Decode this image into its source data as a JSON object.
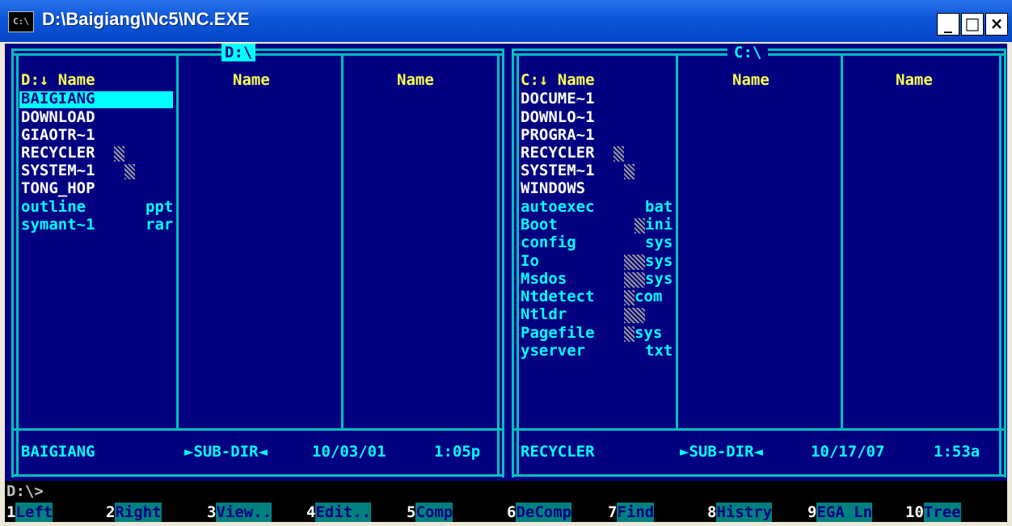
{
  "window": {
    "title": "D:\\Baigiang\\Nc5\\NC.EXE",
    "icon_label": "C:\\",
    "minimize": "_",
    "maximize": "□",
    "close": "×"
  },
  "left_panel": {
    "drive_header": "D:\\",
    "col1_header": "D:↓ Name",
    "col2_header": "Name",
    "col3_header": "Name",
    "files": [
      {
        "name": "BAIGIANG",
        "ext": "",
        "type": "dir",
        "selected": true
      },
      {
        "name": "DOWNLOAD",
        "ext": "",
        "type": "dir"
      },
      {
        "name": "GIAOTR~1",
        "ext": "",
        "type": "dir"
      },
      {
        "name": "RECYCLER",
        "ext": "",
        "type": "dir",
        "hidden": true
      },
      {
        "name": "SYSTEM~1",
        "ext": "",
        "type": "dir",
        "hidden": true
      },
      {
        "name": "TONG_HOP",
        "ext": "",
        "type": "dir"
      },
      {
        "name": "outline",
        "ext": "ppt",
        "type": "file"
      },
      {
        "name": "symant~1",
        "ext": "rar",
        "type": "file"
      }
    ],
    "status_name": "BAIGIANG",
    "status_type": "►SUB-DIR◄",
    "status_date": "10/03/01",
    "status_time": "1:05p"
  },
  "right_panel": {
    "drive_header": "C:\\",
    "col1_header": "C:↓ Name",
    "col2_header": "Name",
    "col3_header": "Name",
    "files": [
      {
        "name": "DOCUME~1",
        "ext": "",
        "type": "dir"
      },
      {
        "name": "DOWNLO~1",
        "ext": "",
        "type": "dir"
      },
      {
        "name": "PROGRA~1",
        "ext": "",
        "type": "dir"
      },
      {
        "name": "RECYCLER",
        "ext": "",
        "type": "dir",
        "hidden": true
      },
      {
        "name": "SYSTEM~1",
        "ext": "",
        "type": "dir",
        "hidden": true
      },
      {
        "name": "WINDOWS",
        "ext": "",
        "type": "dir"
      },
      {
        "name": "autoexec",
        "ext": "bat",
        "type": "file"
      },
      {
        "name": "Boot",
        "ext": "ini",
        "type": "file",
        "hidden": true
      },
      {
        "name": "config",
        "ext": "sys",
        "type": "file"
      },
      {
        "name": "Io",
        "ext": "sys",
        "type": "file",
        "hidden": true
      },
      {
        "name": "Msdos",
        "ext": "sys",
        "type": "file",
        "hidden": true
      },
      {
        "name": "Ntdetect",
        "ext": "com",
        "type": "file",
        "hidden": true
      },
      {
        "name": "Ntldr",
        "ext": "",
        "type": "file",
        "hidden": true
      },
      {
        "name": "Pagefile",
        "ext": "sys",
        "type": "file",
        "hidden": true
      },
      {
        "name": "yserver",
        "ext": "txt",
        "type": "file"
      }
    ],
    "status_name": "RECYCLER",
    "status_type": "►SUB-DIR◄",
    "status_date": "10/17/07",
    "status_time": "1:53a"
  },
  "prompt": "D:\\>",
  "fkeys": [
    {
      "num": "1",
      "label": "Left  "
    },
    {
      "num": "2",
      "label": "Right "
    },
    {
      "num": "3",
      "label": "View.."
    },
    {
      "num": "4",
      "label": "Edit.."
    },
    {
      "num": "5",
      "label": "Comp  "
    },
    {
      "num": "6",
      "label": "DeComp"
    },
    {
      "num": "7",
      "label": "Find  "
    },
    {
      "num": "8",
      "label": "Histry"
    },
    {
      "num": "9",
      "label": "EGA Ln"
    },
    {
      "num": "10",
      "label": "Tree  "
    }
  ],
  "colors": {
    "panel_bg": "#000080",
    "frame": "#00c0c0",
    "dir_text": "#ffffff",
    "file_text": "#00ffff",
    "header_text": "#ffff55",
    "cursor_bg": "#00ffff",
    "fkey_bg": "#008080"
  }
}
